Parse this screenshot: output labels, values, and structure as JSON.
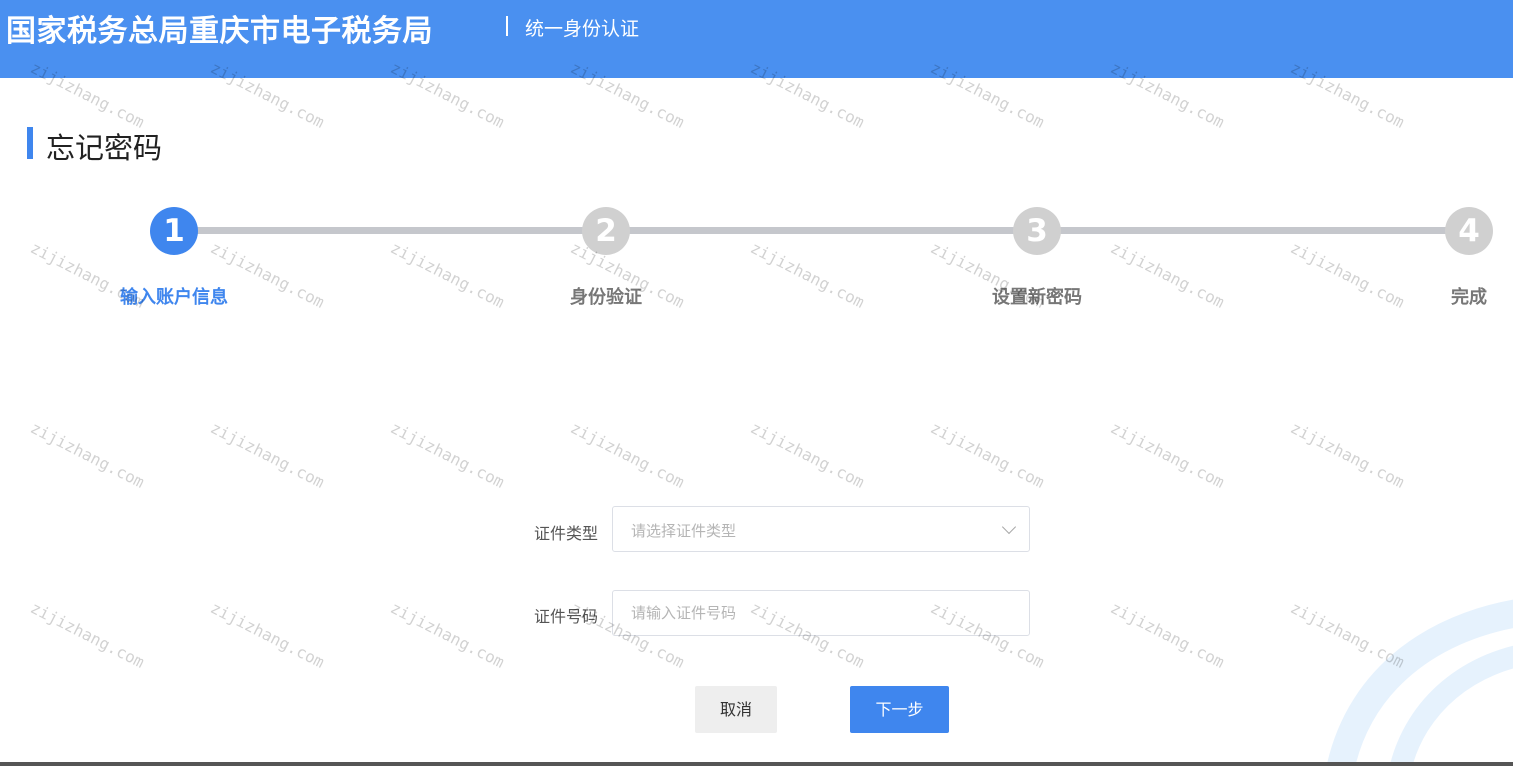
{
  "header": {
    "title": "国家税务总局重庆市电子税务局",
    "subtitle": "统一身份认证"
  },
  "page": {
    "title": "忘记密码"
  },
  "steps": [
    {
      "number": "1",
      "label": "输入账户信息",
      "active": true
    },
    {
      "number": "2",
      "label": "身份验证",
      "active": false
    },
    {
      "number": "3",
      "label": "设置新密码",
      "active": false
    },
    {
      "number": "4",
      "label": "完成",
      "active": false
    }
  ],
  "form": {
    "id_type": {
      "label": "证件类型",
      "placeholder": "请选择证件类型"
    },
    "id_number": {
      "label": "证件号码",
      "placeholder": "请输入证件号码"
    }
  },
  "buttons": {
    "cancel": "取消",
    "next": "下一步"
  },
  "watermark": "zijizhang.com",
  "colors": {
    "header_bg": "#4a90f0",
    "accent": "#3f86ee",
    "inactive_step": "#d0d0d0"
  }
}
